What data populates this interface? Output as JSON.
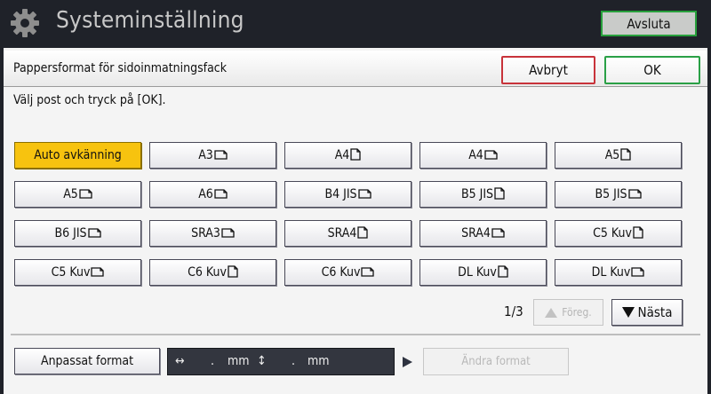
{
  "header": {
    "icon": "gear-icon",
    "title": "Systeminställning",
    "exit_label": "Avsluta"
  },
  "dialog": {
    "title": "Pappersformat för sidoinmatningsfack",
    "cancel_label": "Avbryt",
    "ok_label": "OK",
    "instruction": "Välj post och tryck på [OK]."
  },
  "sizes": [
    {
      "label": "Auto avkänning",
      "orientation": "",
      "selected": true
    },
    {
      "label": "A3",
      "orientation": "landscape"
    },
    {
      "label": "A4",
      "orientation": "portrait"
    },
    {
      "label": "A4",
      "orientation": "landscape"
    },
    {
      "label": "A5",
      "orientation": "portrait"
    },
    {
      "label": "A5",
      "orientation": "landscape"
    },
    {
      "label": "A6",
      "orientation": "landscape"
    },
    {
      "label": "B4 JIS",
      "orientation": "landscape"
    },
    {
      "label": "B5 JIS",
      "orientation": "portrait"
    },
    {
      "label": "B5 JIS",
      "orientation": "landscape"
    },
    {
      "label": "B6 JIS",
      "orientation": "landscape"
    },
    {
      "label": "SRA3",
      "orientation": "landscape"
    },
    {
      "label": "SRA4",
      "orientation": "portrait"
    },
    {
      "label": "SRA4",
      "orientation": "landscape"
    },
    {
      "label": "C5 Kuv",
      "orientation": "portrait"
    },
    {
      "label": "C5 Kuv",
      "orientation": "landscape"
    },
    {
      "label": "C6 Kuv",
      "orientation": "portrait"
    },
    {
      "label": "C6 Kuv",
      "orientation": "landscape"
    },
    {
      "label": "DL Kuv",
      "orientation": "portrait"
    },
    {
      "label": "DL Kuv",
      "orientation": "landscape"
    }
  ],
  "pager": {
    "page_text": "1/3",
    "prev_label": "Föreg.",
    "next_label": "Nästa"
  },
  "custom": {
    "button_label": "Anpassat format",
    "width_symbol": "↔",
    "width_value": ".",
    "width_unit": "mm",
    "height_symbol": "↕",
    "height_value": ".",
    "height_unit": "mm",
    "change_label": "Ändra format"
  },
  "colors": {
    "selected": "#f7c30f",
    "ok_border": "#2aa046",
    "cancel_border": "#c8333a",
    "header_bg": "#1f2229"
  }
}
